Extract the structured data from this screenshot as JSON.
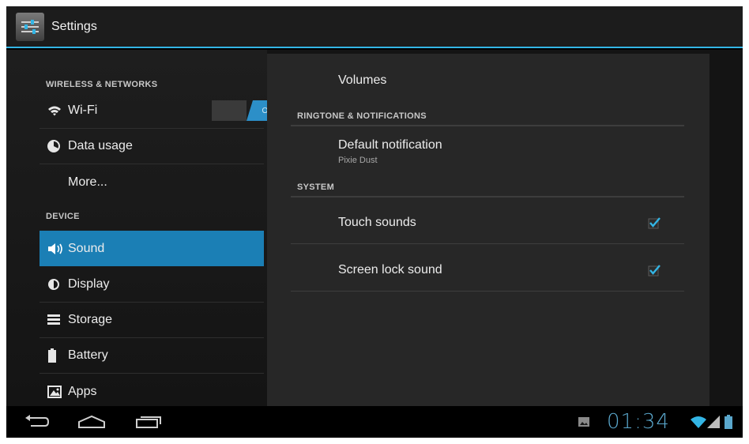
{
  "action_bar": {
    "title": "Settings",
    "icon": "settings-icon"
  },
  "sidebar": {
    "headers": {
      "wireless": "WIRELESS & NETWORKS",
      "device": "DEVICE"
    },
    "items": [
      {
        "label": "Wi-Fi",
        "icon": "wifi-icon",
        "toggle": "ON"
      },
      {
        "label": "Data usage",
        "icon": "data-usage-icon"
      },
      {
        "label": "More..."
      },
      {
        "label": "Sound",
        "icon": "sound-icon",
        "selected": true
      },
      {
        "label": "Display",
        "icon": "display-icon"
      },
      {
        "label": "Storage",
        "icon": "storage-icon"
      },
      {
        "label": "Battery",
        "icon": "battery-icon"
      },
      {
        "label": "Apps",
        "icon": "apps-icon"
      }
    ]
  },
  "sound": {
    "volumes": "Volumes",
    "ringtone_header": "RINGTONE & NOTIFICATIONS",
    "default_notification": {
      "title": "Default notification",
      "summary": "Pixie Dust"
    },
    "system_header": "SYSTEM",
    "touch_sounds": {
      "title": "Touch sounds",
      "checked": true
    },
    "screen_lock_sound": {
      "title": "Screen lock sound",
      "checked": true
    }
  },
  "system_bar": {
    "time": "01:34"
  },
  "colors": {
    "accent": "#33b5e5",
    "selected": "#1b7fb5",
    "clock": "#5aa7cc"
  }
}
